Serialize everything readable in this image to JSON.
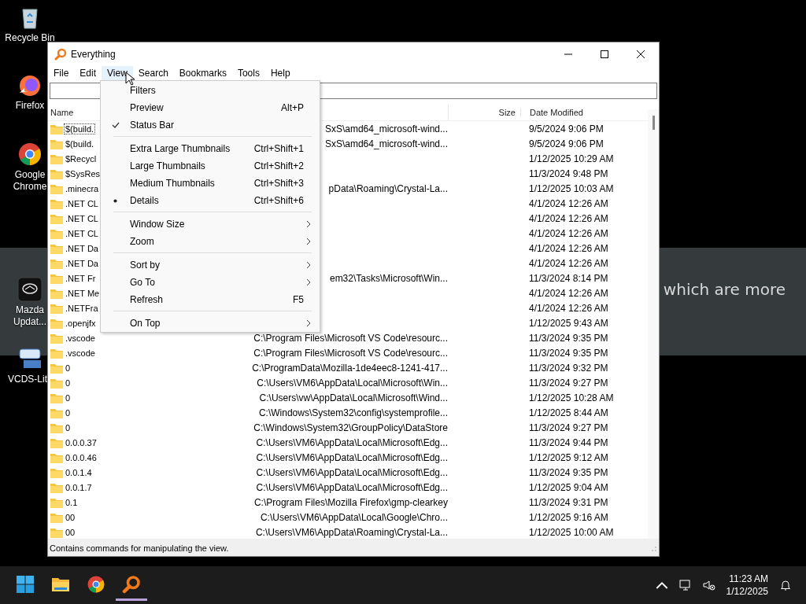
{
  "desktop": {
    "icons": [
      {
        "label": "Recycle Bin",
        "kind": "recycle"
      },
      {
        "label": "Firefox",
        "kind": "firefox"
      },
      {
        "label": "Google Chrome",
        "kind": "chrome"
      },
      {
        "label": "Mazda Updat...",
        "kind": "mazda"
      },
      {
        "label": "VCDS-Lit",
        "kind": "vcds"
      }
    ],
    "banner": "which are more"
  },
  "window": {
    "title": "Everything"
  },
  "menubar": [
    {
      "label": "File",
      "selected": false
    },
    {
      "label": "Edit",
      "selected": false
    },
    {
      "label": "View",
      "selected": true
    },
    {
      "label": "Search",
      "selected": false
    },
    {
      "label": "Bookmarks",
      "selected": false
    },
    {
      "label": "Tools",
      "selected": false
    },
    {
      "label": "Help",
      "selected": false
    }
  ],
  "view_menu": [
    {
      "kind": "toggle",
      "label": "Filters",
      "checked": false
    },
    {
      "kind": "toggle",
      "label": "Preview",
      "shortcut": "Alt+P",
      "checked": false
    },
    {
      "kind": "toggle",
      "label": "Status Bar",
      "checked": true
    },
    {
      "kind": "separator"
    },
    {
      "kind": "radio",
      "label": "Extra Large Thumbnails",
      "shortcut": "Ctrl+Shift+1",
      "checked": false
    },
    {
      "kind": "radio",
      "label": "Large Thumbnails",
      "shortcut": "Ctrl+Shift+2",
      "checked": false
    },
    {
      "kind": "radio",
      "label": "Medium Thumbnails",
      "shortcut": "Ctrl+Shift+3",
      "checked": false
    },
    {
      "kind": "radio",
      "label": "Details",
      "shortcut": "Ctrl+Shift+6",
      "checked": true
    },
    {
      "kind": "separator"
    },
    {
      "kind": "submenu",
      "label": "Window Size"
    },
    {
      "kind": "submenu",
      "label": "Zoom"
    },
    {
      "kind": "separator"
    },
    {
      "kind": "submenu",
      "label": "Sort by"
    },
    {
      "kind": "submenu",
      "label": "Go To"
    },
    {
      "kind": "item",
      "label": "Refresh",
      "shortcut": "F5"
    },
    {
      "kind": "separator"
    },
    {
      "kind": "submenu",
      "label": "On Top"
    }
  ],
  "table": {
    "columns": [
      "Name",
      "Size",
      "Date Modified"
    ],
    "rows": [
      {
        "name": "$(build.",
        "path": "SxS\\amd64_microsoft-wind...",
        "date": "9/5/2024 9:06 PM",
        "focused": true
      },
      {
        "name": "$(build.",
        "path": "SxS\\amd64_microsoft-wind...",
        "date": "9/5/2024 9:06 PM",
        "focused": false
      },
      {
        "name": "$Recycl",
        "date": "1/12/2025 10:29 AM",
        "focused": false
      },
      {
        "name": "$SysRes",
        "date": "11/3/2024 9:48 PM",
        "focused": false
      },
      {
        "name": ".minecra",
        "path": "pData\\Roaming\\Crystal-La...",
        "date": "1/12/2025 10:03 AM",
        "focused": false
      },
      {
        "name": ".NET CL",
        "date": "4/1/2024 12:26 AM",
        "focused": false
      },
      {
        "name": ".NET CL",
        "date": "4/1/2024 12:26 AM",
        "focused": false
      },
      {
        "name": ".NET CL",
        "date": "4/1/2024 12:26 AM",
        "focused": false
      },
      {
        "name": ".NET Da",
        "date": "4/1/2024 12:26 AM",
        "focused": false
      },
      {
        "name": ".NET Da",
        "date": "4/1/2024 12:26 AM",
        "focused": false
      },
      {
        "name": ".NET Fr",
        "path": "em32\\Tasks\\Microsoft\\Win...",
        "date": "11/3/2024 8:14 PM",
        "focused": false
      },
      {
        "name": ".NET Me",
        "date": "4/1/2024 12:26 AM",
        "focused": false
      },
      {
        "name": ".NETFra",
        "date": "4/1/2024 12:26 AM",
        "focused": false
      },
      {
        "name": ".openjfx",
        "date": "1/12/2025 9:43 AM",
        "focused": false
      },
      {
        "name": ".vscode",
        "path": "C:\\Program Files\\Microsoft VS Code\\resourc...",
        "date": "11/3/2024 9:35 PM",
        "focused": false
      },
      {
        "name": ".vscode",
        "path": "C:\\Program Files\\Microsoft VS Code\\resourc...",
        "date": "11/3/2024 9:35 PM",
        "focused": false
      },
      {
        "name": "0",
        "path": "C:\\ProgramData\\Mozilla-1de4eec8-1241-417...",
        "date": "11/3/2024 9:32 PM",
        "focused": false
      },
      {
        "name": "0",
        "path": "C:\\Users\\VM6\\AppData\\Local\\Microsoft\\Win...",
        "date": "11/3/2024 9:27 PM",
        "focused": false
      },
      {
        "name": "0",
        "path": "C:\\Users\\vw\\AppData\\Local\\Microsoft\\Wind...",
        "date": "1/12/2025 10:28 AM",
        "focused": false
      },
      {
        "name": "0",
        "path": "C:\\Windows\\System32\\config\\systemprofile...",
        "date": "1/12/2025 8:44 AM",
        "focused": false
      },
      {
        "name": "0",
        "path": "C:\\Windows\\System32\\GroupPolicy\\DataStore",
        "date": "11/3/2024 9:27 PM",
        "focused": false
      },
      {
        "name": "0.0.0.37",
        "path": "C:\\Users\\VM6\\AppData\\Local\\Microsoft\\Edg...",
        "date": "11/3/2024 9:44 PM",
        "focused": false
      },
      {
        "name": "0.0.0.46",
        "path": "C:\\Users\\VM6\\AppData\\Local\\Microsoft\\Edg...",
        "date": "1/12/2025 9:12 AM",
        "focused": false
      },
      {
        "name": "0.0.1.4",
        "path": "C:\\Users\\VM6\\AppData\\Local\\Microsoft\\Edg...",
        "date": "11/3/2024 9:35 PM",
        "focused": false
      },
      {
        "name": "0.0.1.7",
        "path": "C:\\Users\\VM6\\AppData\\Local\\Microsoft\\Edg...",
        "date": "1/12/2025 9:04 AM",
        "focused": false
      },
      {
        "name": "0.1",
        "path": "C:\\Program Files\\Mozilla Firefox\\gmp-clearkey",
        "date": "11/3/2024 9:31 PM",
        "focused": false
      },
      {
        "name": "00",
        "path": "C:\\Users\\VM6\\AppData\\Local\\Google\\Chro...",
        "date": "1/12/2025 9:16 AM",
        "focused": false
      },
      {
        "name": "00",
        "path": "C:\\Users\\VM6\\AppData\\Roaming\\Crystal-La...",
        "date": "1/12/2025 10:00 AM",
        "focused": false
      }
    ]
  },
  "status_bar": "Contains commands for manipulating the view.",
  "taskbar": {
    "apps": [
      {
        "kind": "start",
        "running": false
      },
      {
        "kind": "explorer",
        "running": false
      },
      {
        "kind": "chrome",
        "running": false
      },
      {
        "kind": "everything",
        "running": true
      }
    ],
    "time": "11:23 AM",
    "date": "1/12/2025"
  }
}
